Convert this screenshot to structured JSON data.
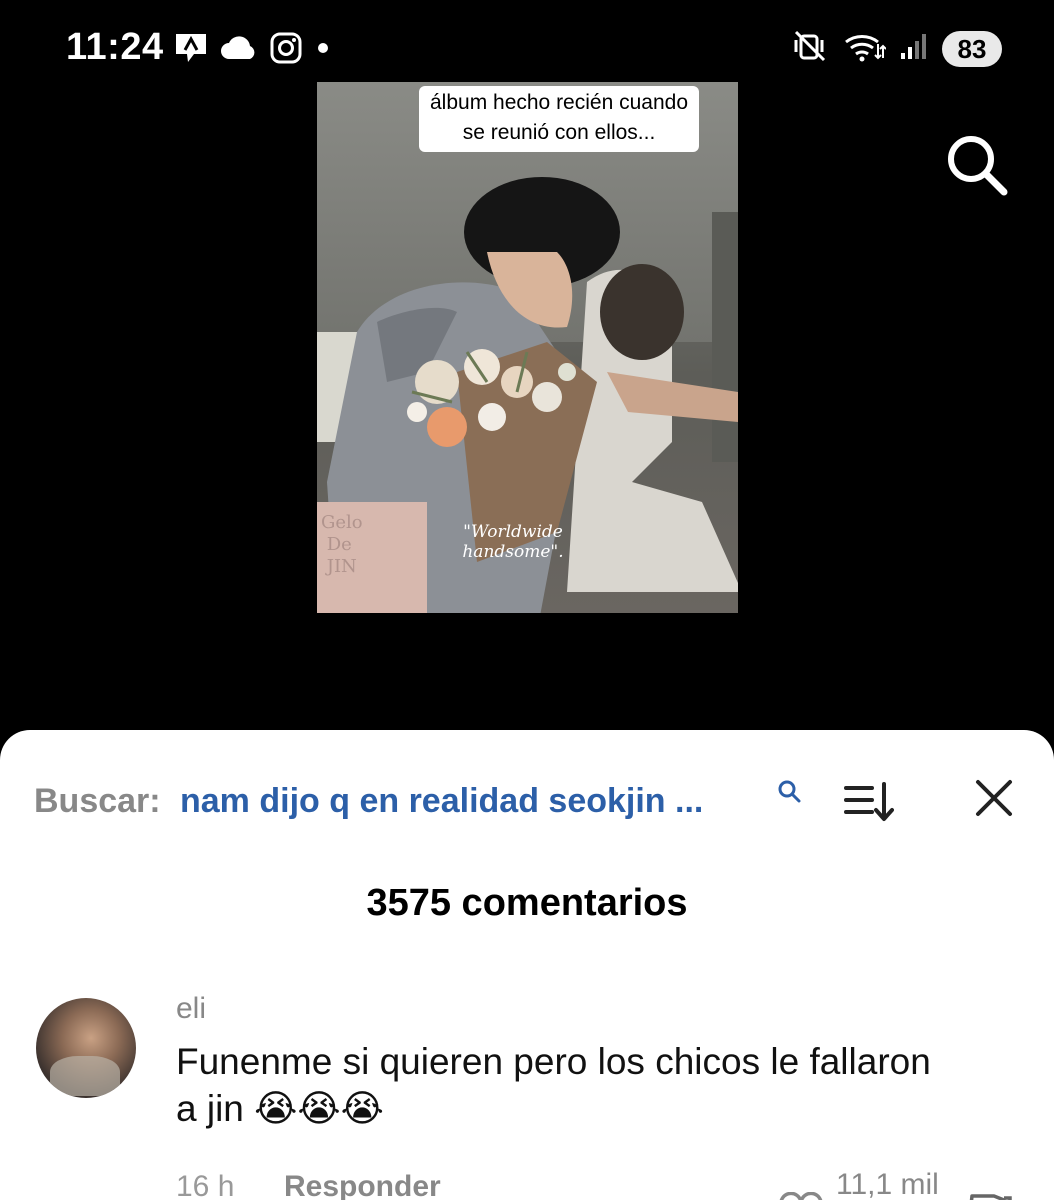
{
  "status_bar": {
    "time": "11:24",
    "battery": "83",
    "left_icons": [
      "arrow-notification-icon",
      "cloud-icon",
      "instagram-icon",
      "dot-icon"
    ],
    "right_icons": [
      "mute-vibrate-icon",
      "wifi-icon",
      "signal-icon",
      "battery-icon"
    ]
  },
  "video": {
    "caption": "álbum hecho recién cuando se reunió con ellos...",
    "overlay_text": "\"Worldwide handsome\".",
    "bag_text": "Gelo\nDe\nJIN"
  },
  "search": {
    "label": "Buscar:",
    "query": "nam dijo q en realidad seokjin ..."
  },
  "comments": {
    "count_label": "3575 comentarios",
    "items": [
      {
        "username": "eli",
        "text": "Funenme si quieren pero los chicos le fallaron a jin 😭😭😭",
        "time": "16 h",
        "reply_label": "Responder",
        "likes": "11,1 mil"
      }
    ]
  }
}
